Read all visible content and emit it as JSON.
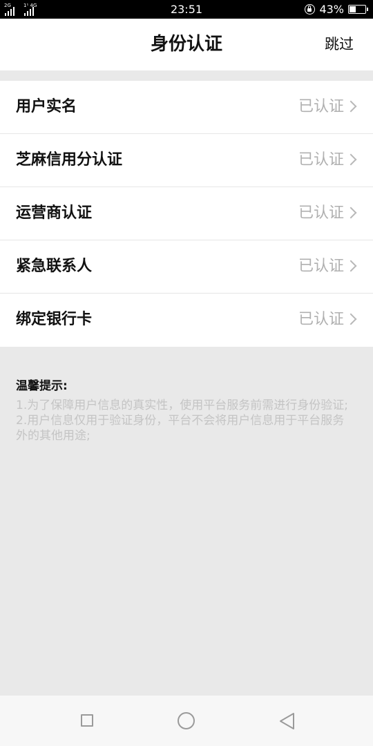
{
  "status_bar": {
    "time": "23:51",
    "battery_percent": "43%",
    "battery_level": 0.43,
    "signal_tags": [
      "2G",
      "1¹ 4G"
    ],
    "icons": [
      "signal-icon",
      "lock-rotation-icon",
      "battery-icon"
    ]
  },
  "header": {
    "title": "身份认证",
    "skip_label": "跳过"
  },
  "verification_items": [
    {
      "label": "用户实名",
      "status": "已认证"
    },
    {
      "label": "芝麻信用分认证",
      "status": "已认证"
    },
    {
      "label": "运营商认证",
      "status": "已认证"
    },
    {
      "label": "紧急联系人",
      "status": "已认证"
    },
    {
      "label": "绑定银行卡",
      "status": "已认证"
    }
  ],
  "tips": {
    "title": "温馨提示:",
    "line1": "1.为了保障用户信息的真实性，使用平台服务前需进行身份验证;",
    "line2": "2.用户信息仅用于验证身份，平台不会将用户信息用于平台服务外的其他用途;"
  },
  "nav_bar": {
    "icons": [
      "recent-apps-icon",
      "home-icon",
      "back-icon"
    ]
  },
  "colors": {
    "background": "#e9e9e9",
    "card": "#ffffff",
    "status_text": "#b0b0b0",
    "tips_text": "#c4c4c4",
    "primary_text": "#111111"
  }
}
